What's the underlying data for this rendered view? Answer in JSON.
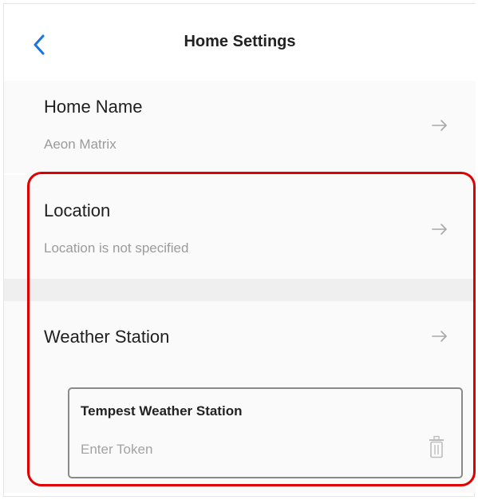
{
  "header": {
    "title": "Home Settings",
    "back_icon": "chevron-left-icon"
  },
  "home_name": {
    "label": "Home Name",
    "value": "Aeon Matrix"
  },
  "location": {
    "label": "Location",
    "value": "Location is not specified"
  },
  "weather_station": {
    "label": "Weather Station",
    "card_title": "Tempest Weather Station",
    "token_placeholder": "Enter Token",
    "token_value": ""
  },
  "colors": {
    "accent": "#1a73e8",
    "highlight": "#e00000",
    "muted_text": "#9b9b9b",
    "arrow": "#a8a8a8"
  }
}
